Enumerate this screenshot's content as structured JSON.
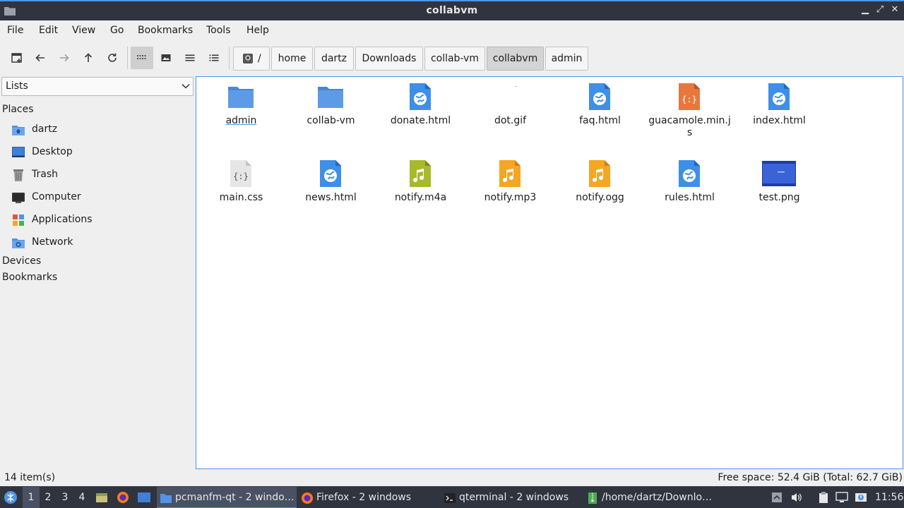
{
  "window": {
    "title": "collabvm"
  },
  "menu": [
    "File",
    "Edit",
    "View",
    "Go",
    "Bookmarks",
    "Tools",
    "Help"
  ],
  "breadcrumb": [
    "/",
    "home",
    "dartz",
    "Downloads",
    "collab-vm",
    "collabvm",
    "admin"
  ],
  "breadcrumb_active": "collabvm",
  "sidepanel": {
    "mode": "Lists",
    "places_header": "Places",
    "places": [
      {
        "label": "dartz",
        "icon": "home-folder-icon"
      },
      {
        "label": "Desktop",
        "icon": "desktop-icon"
      },
      {
        "label": "Trash",
        "icon": "trash-icon"
      },
      {
        "label": "Computer",
        "icon": "computer-icon"
      },
      {
        "label": "Applications",
        "icon": "applications-icon"
      },
      {
        "label": "Network",
        "icon": "network-icon"
      }
    ],
    "devices_header": "Devices",
    "bookmarks_header": "Bookmarks"
  },
  "files": [
    {
      "name": "admin",
      "type": "folder"
    },
    {
      "name": "collab-vm",
      "type": "folder"
    },
    {
      "name": "donate.html",
      "type": "html"
    },
    {
      "name": "dot.gif",
      "type": "gif"
    },
    {
      "name": "faq.html",
      "type": "html"
    },
    {
      "name": "guacamole.min.js",
      "type": "js"
    },
    {
      "name": "index.html",
      "type": "html"
    },
    {
      "name": "main.css",
      "type": "css"
    },
    {
      "name": "news.html",
      "type": "html"
    },
    {
      "name": "notify.m4a",
      "type": "m4a"
    },
    {
      "name": "notify.mp3",
      "type": "audio"
    },
    {
      "name": "notify.ogg",
      "type": "audio"
    },
    {
      "name": "rules.html",
      "type": "html"
    },
    {
      "name": "test.png",
      "type": "png"
    }
  ],
  "status": {
    "items": "14 item(s)",
    "free_space": "Free space: 52.4 GiB (Total: 62.7 GiB)"
  },
  "taskbar": {
    "desktops": [
      "1",
      "2",
      "3",
      "4"
    ],
    "tasks": [
      {
        "label": "pcmanfm-qt - 2 windo…",
        "icon": "folder-icon",
        "active": true
      },
      {
        "label": "Firefox - 2 windows",
        "icon": "firefox-icon",
        "active": false
      },
      {
        "label": "qterminal - 2 windows",
        "icon": "terminal-icon",
        "active": false
      },
      {
        "label": "/home/dartz/Downlo…",
        "icon": "archive-icon",
        "active": false
      }
    ],
    "clock": "11:56"
  },
  "colors": {
    "accent": "#5294e2",
    "folder": "#5294e2",
    "html": "#3d8fe8",
    "js": "#e8773d",
    "audio": "#f5a623",
    "m4a": "#a8b92a",
    "panel": "#2f343f"
  }
}
